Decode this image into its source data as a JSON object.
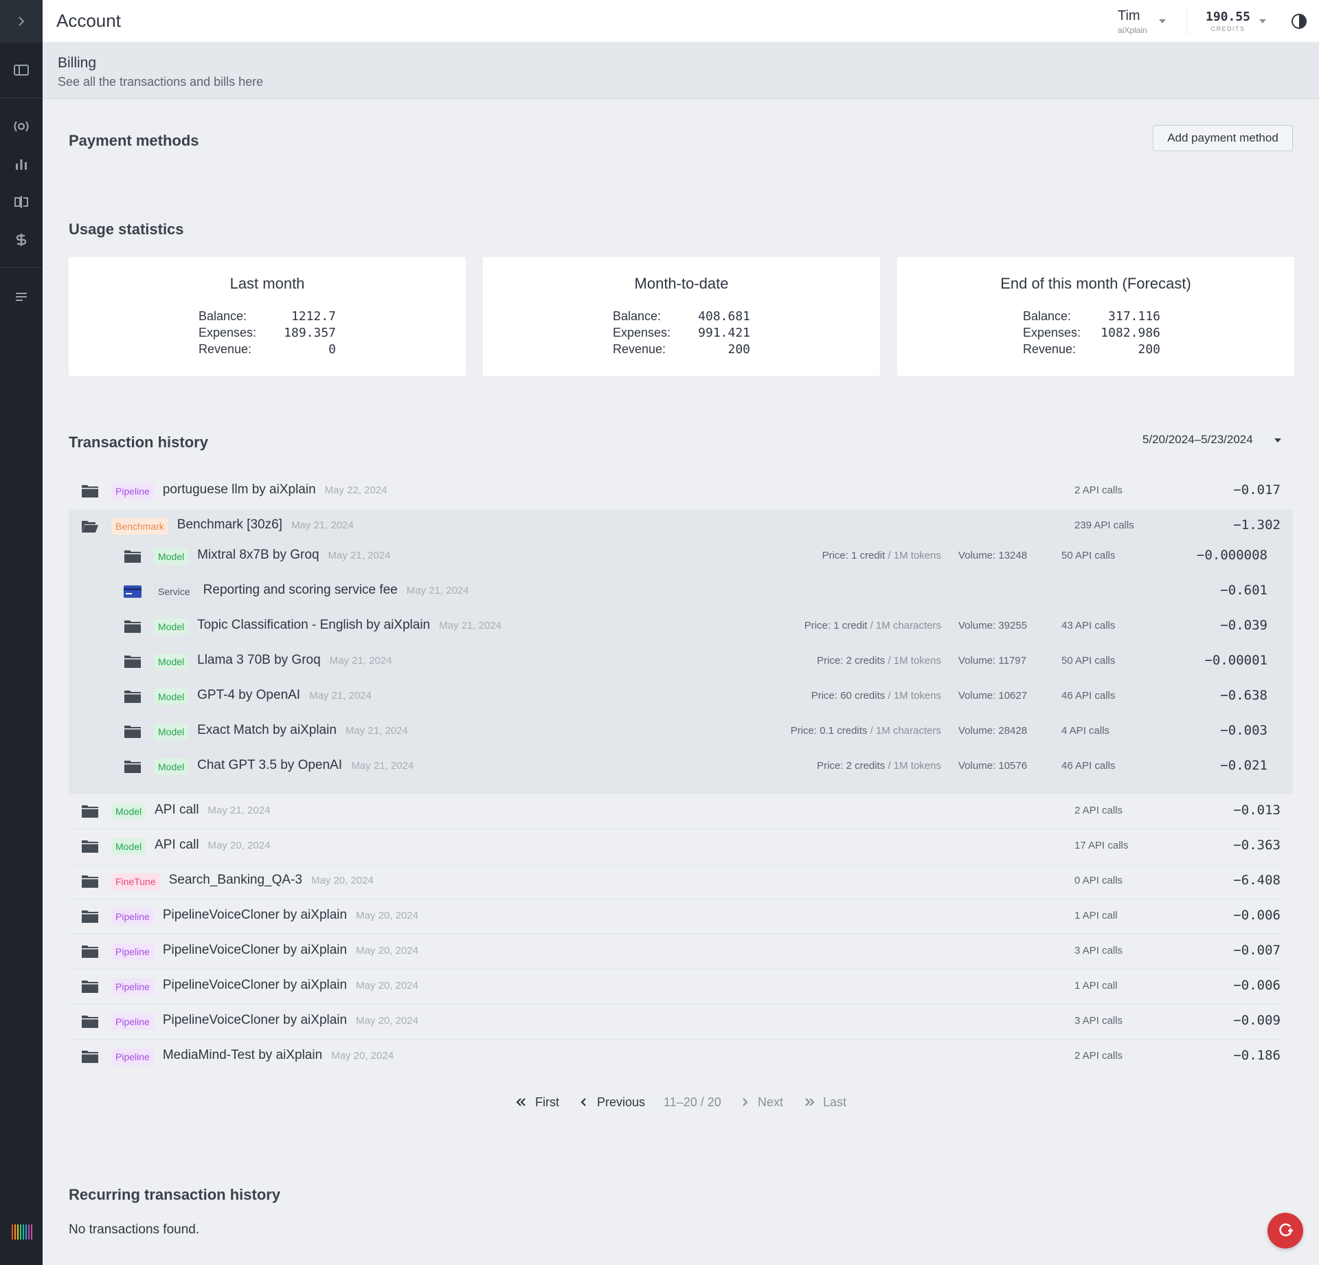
{
  "header": {
    "title": "Account",
    "user_name": "Tim",
    "user_org": "aiXplain",
    "credits_value": "190.55",
    "credits_label": "CREDITS"
  },
  "billing": {
    "title": "Billing",
    "subtitle": "See all the transactions and bills here"
  },
  "payment_methods": {
    "title": "Payment methods",
    "add_button": "Add payment method"
  },
  "usage": {
    "title": "Usage statistics",
    "cards": [
      {
        "title": "Last month",
        "rows": [
          {
            "label": "Balance:",
            "value": "1212.7"
          },
          {
            "label": "Expenses:",
            "value": "189.357"
          },
          {
            "label": "Revenue:",
            "value": "0"
          }
        ]
      },
      {
        "title": "Month-to-date",
        "rows": [
          {
            "label": "Balance:",
            "value": "408.681"
          },
          {
            "label": "Expenses:",
            "value": "991.421"
          },
          {
            "label": "Revenue:",
            "value": "200"
          }
        ]
      },
      {
        "title": "End of this month (Forecast)",
        "rows": [
          {
            "label": "Balance:",
            "value": "317.116"
          },
          {
            "label": "Expenses:",
            "value": "1082.986"
          },
          {
            "label": "Revenue:",
            "value": "200"
          }
        ]
      }
    ]
  },
  "transactions": {
    "title": "Transaction history",
    "date_range": "5/20/2024–5/23/2024",
    "rows": [
      {
        "tag": "Pipeline",
        "name": "portuguese llm by aiXplain",
        "date": "May 22, 2024",
        "calls": "2 API calls",
        "amount": "−0.017",
        "icon": "folder-icon"
      },
      {
        "tag": "Benchmark",
        "name": "Benchmark [30z6]",
        "date": "May 21, 2024",
        "calls": "239 API calls",
        "amount": "−1.302",
        "icon": "folder-open-icon",
        "children": [
          {
            "tag": "Model",
            "name": "Mixtral 8x7B by Groq",
            "date": "May 21, 2024",
            "price_label": "Price:",
            "price": "1 credit",
            "price_unit": "1M tokens",
            "volume_label": "Volume:",
            "volume": "13248",
            "calls": "50 API calls",
            "amount": "−0.000008",
            "icon": "folder-icon"
          },
          {
            "tag": "Service",
            "name": "Reporting and scoring service fee",
            "date": "May 21, 2024",
            "amount": "−0.601",
            "icon": "credit-card-icon"
          },
          {
            "tag": "Model",
            "name": "Topic Classification - English by aiXplain",
            "date": "May 21, 2024",
            "price_label": "Price:",
            "price": "1 credit",
            "price_unit": "1M characters",
            "volume_label": "Volume:",
            "volume": "39255",
            "calls": "43 API calls",
            "amount": "−0.039",
            "icon": "folder-icon"
          },
          {
            "tag": "Model",
            "name": "Llama 3 70B by Groq",
            "date": "May 21, 2024",
            "price_label": "Price:",
            "price": "2 credits",
            "price_unit": "1M tokens",
            "volume_label": "Volume:",
            "volume": "11797",
            "calls": "50 API calls",
            "amount": "−0.00001",
            "icon": "folder-icon"
          },
          {
            "tag": "Model",
            "name": "GPT-4 by OpenAI",
            "date": "May 21, 2024",
            "price_label": "Price:",
            "price": "60 credits",
            "price_unit": "1M tokens",
            "volume_label": "Volume:",
            "volume": "10627",
            "calls": "46 API calls",
            "amount": "−0.638",
            "icon": "folder-icon"
          },
          {
            "tag": "Model",
            "name": "Exact Match by aiXplain",
            "date": "May 21, 2024",
            "price_label": "Price:",
            "price": "0.1 credits",
            "price_unit": "1M characters",
            "volume_label": "Volume:",
            "volume": "28428",
            "calls": "4 API calls",
            "amount": "−0.003",
            "icon": "folder-icon"
          },
          {
            "tag": "Model",
            "name": "Chat GPT 3.5 by OpenAI",
            "date": "May 21, 2024",
            "price_label": "Price:",
            "price": "2 credits",
            "price_unit": "1M tokens",
            "volume_label": "Volume:",
            "volume": "10576",
            "calls": "46 API calls",
            "amount": "−0.021",
            "icon": "folder-icon"
          }
        ]
      },
      {
        "tag": "Model",
        "name": "API call",
        "date": "May 21, 2024",
        "calls": "2 API calls",
        "amount": "−0.013",
        "icon": "folder-icon"
      },
      {
        "tag": "Model",
        "name": "API call",
        "date": "May 20, 2024",
        "calls": "17 API calls",
        "amount": "−0.363",
        "icon": "folder-icon"
      },
      {
        "tag": "FineTune",
        "name": "Search_Banking_QA-3",
        "date": "May 20, 2024",
        "calls": "0 API calls",
        "amount": "−6.408",
        "icon": "folder-icon"
      },
      {
        "tag": "Pipeline",
        "name": "PipelineVoiceCloner by aiXplain",
        "date": "May 20, 2024",
        "calls": "1 API call",
        "amount": "−0.006",
        "icon": "folder-icon"
      },
      {
        "tag": "Pipeline",
        "name": "PipelineVoiceCloner by aiXplain",
        "date": "May 20, 2024",
        "calls": "3 API calls",
        "amount": "−0.007",
        "icon": "folder-icon"
      },
      {
        "tag": "Pipeline",
        "name": "PipelineVoiceCloner by aiXplain",
        "date": "May 20, 2024",
        "calls": "1 API call",
        "amount": "−0.006",
        "icon": "folder-icon"
      },
      {
        "tag": "Pipeline",
        "name": "PipelineVoiceCloner by aiXplain",
        "date": "May 20, 2024",
        "calls": "3 API calls",
        "amount": "−0.009",
        "icon": "folder-icon"
      },
      {
        "tag": "Pipeline",
        "name": "MediaMind-Test by aiXplain",
        "date": "May 20, 2024",
        "calls": "2 API calls",
        "amount": "−0.186",
        "icon": "folder-icon"
      }
    ]
  },
  "pagination": {
    "first": "First",
    "previous": "Previous",
    "range": "11–20 / 20",
    "next": "Next",
    "last": "Last"
  },
  "recurring": {
    "title": "Recurring transaction history",
    "empty": "No transactions found."
  },
  "colors": {
    "sidebar": "#1f242b",
    "accent_red": "#d7363b"
  }
}
